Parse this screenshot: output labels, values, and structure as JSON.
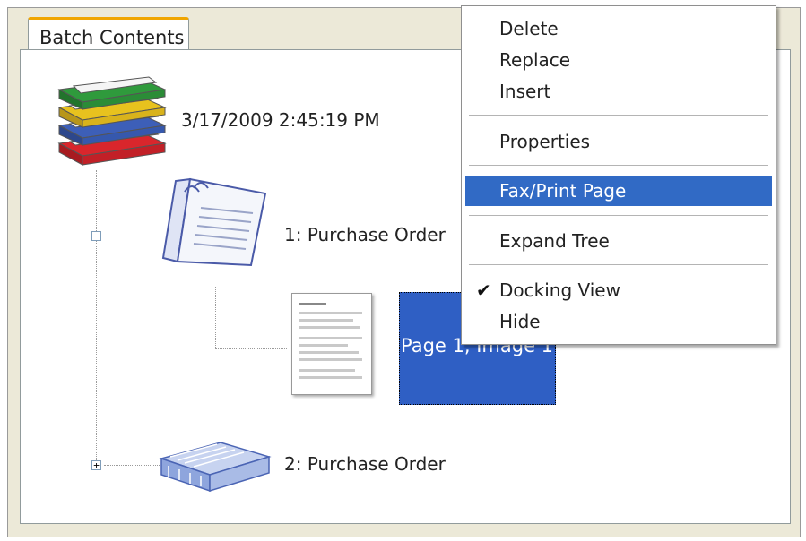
{
  "tab": {
    "label": "Batch Contents"
  },
  "tree": {
    "root": {
      "label": "3/17/2009 2:45:19 PM"
    },
    "nodes": [
      {
        "label": "1: Purchase Order",
        "expander": "−"
      },
      {
        "label": "2: Purchase Order",
        "expander": "+"
      }
    ],
    "page": {
      "label": "Page 1, Image 1"
    }
  },
  "context_menu": {
    "items": [
      {
        "label": "Delete"
      },
      {
        "label": "Replace"
      },
      {
        "label": "Insert"
      },
      {
        "label": "Properties"
      },
      {
        "label": "Fax/Print Page",
        "highlighted": true
      },
      {
        "label": "Expand Tree"
      },
      {
        "label": "Docking View",
        "checked": true
      },
      {
        "label": "Hide"
      }
    ],
    "check_glyph": "✔"
  },
  "colors": {
    "selection": "#2f5fc4",
    "menu_highlight": "#316ac5",
    "tab_accent": "#f0a500"
  }
}
